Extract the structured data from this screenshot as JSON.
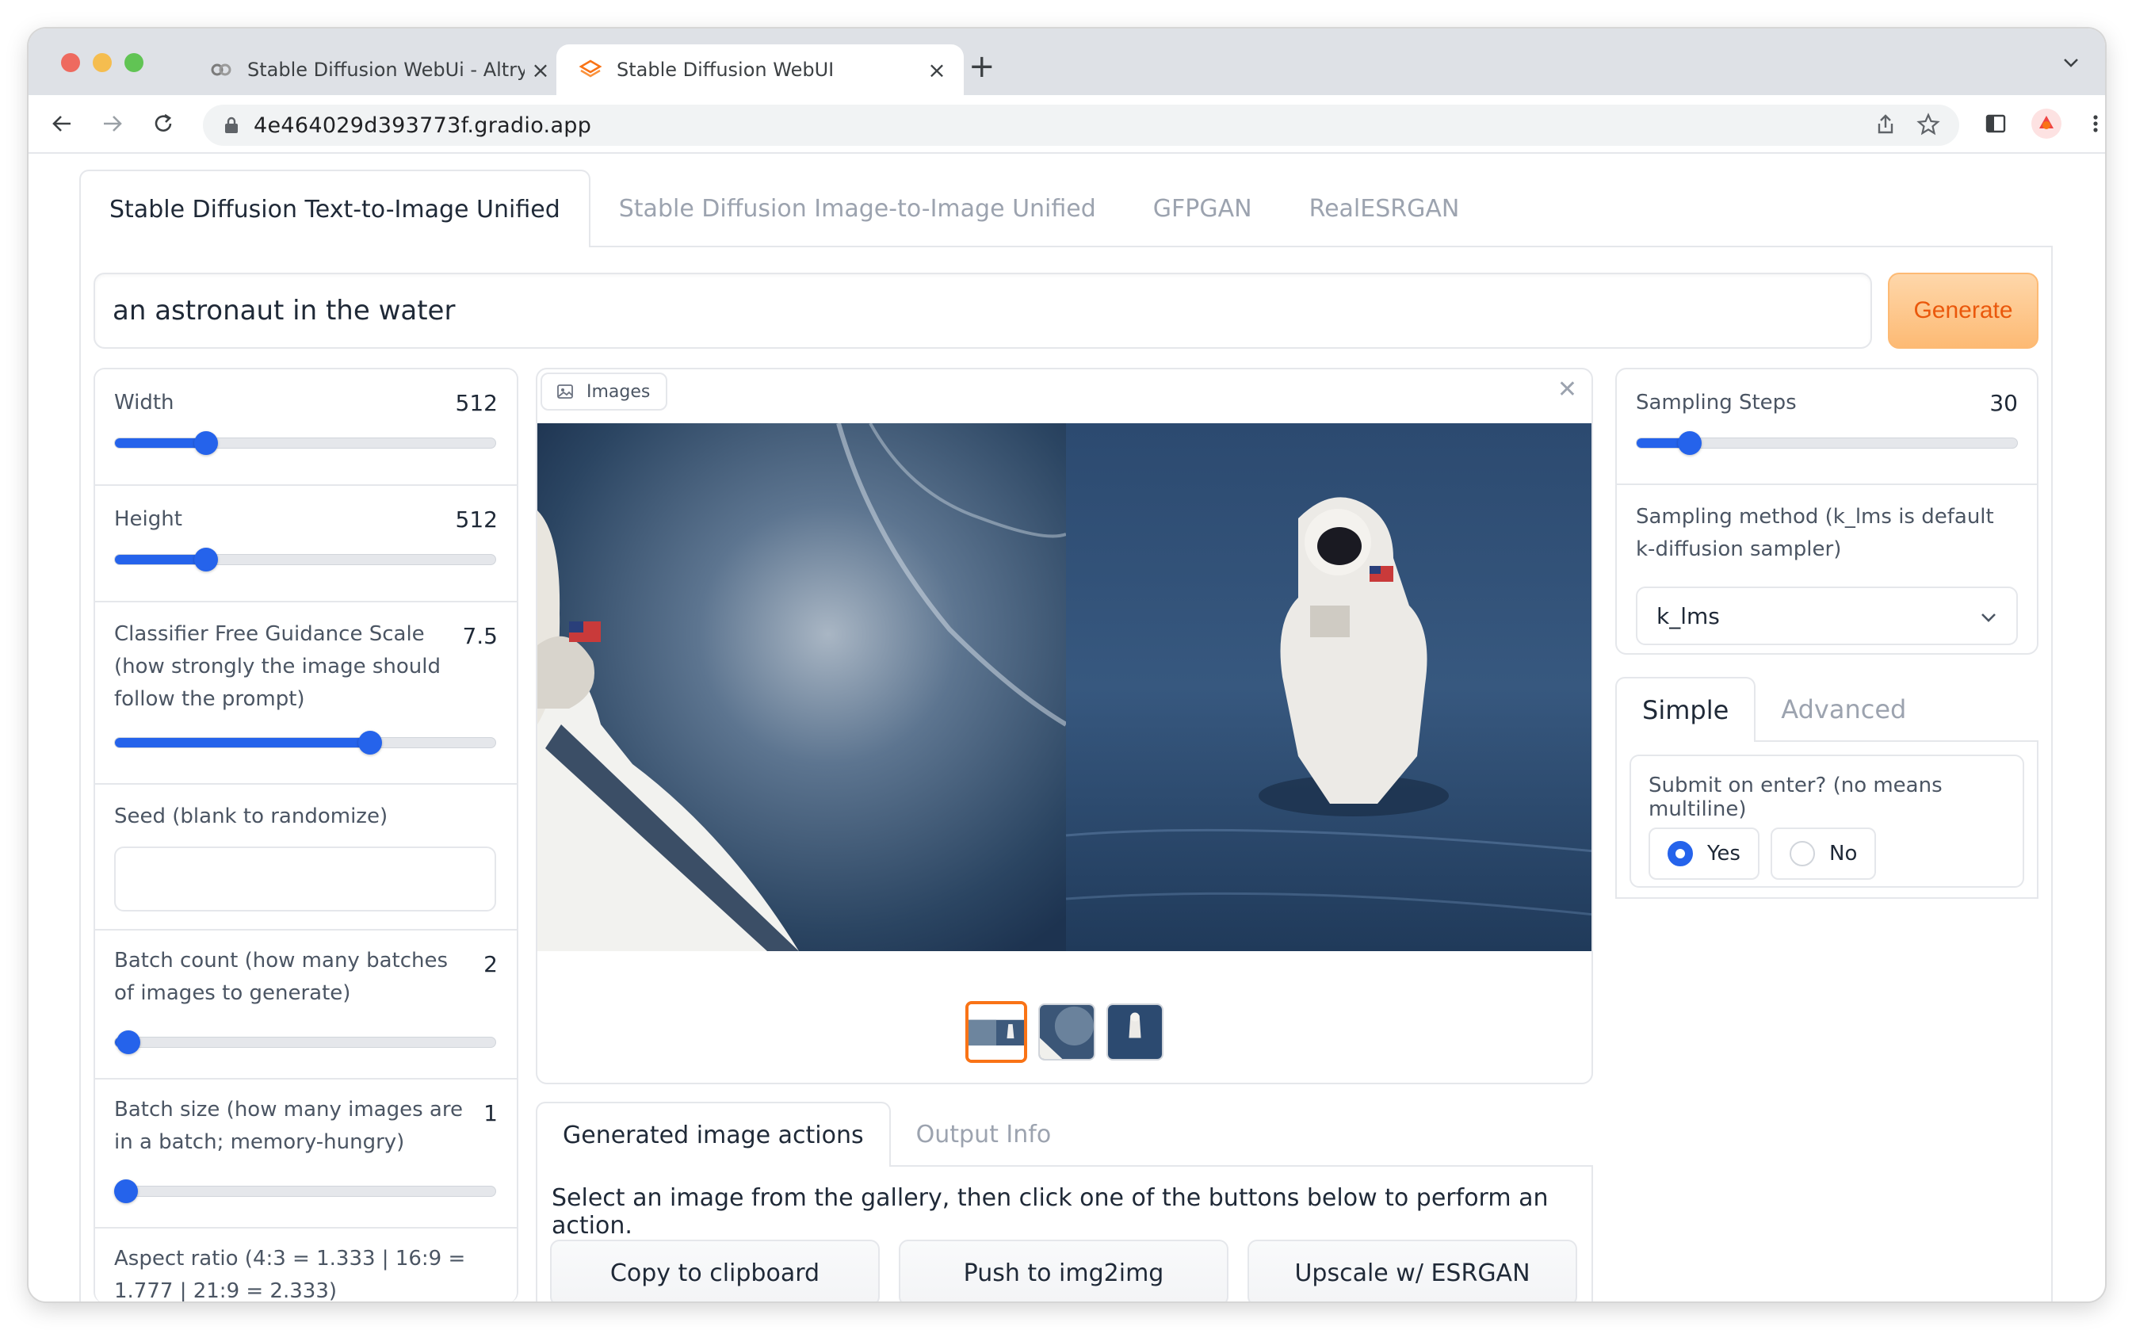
{
  "browser": {
    "tabs": [
      {
        "title": "Stable Diffusion WebUi - Altryne",
        "active": false
      },
      {
        "title": "Stable Diffusion WebUI",
        "active": true
      }
    ],
    "url": "4e464029d393773f.gradio.app"
  },
  "app": {
    "main_tabs": [
      {
        "label": "Stable Diffusion Text-to-Image Unified",
        "active": true
      },
      {
        "label": "Stable Diffusion Image-to-Image Unified",
        "active": false
      },
      {
        "label": "GFPGAN",
        "active": false
      },
      {
        "label": "RealESRGAN",
        "active": false
      }
    ],
    "prompt": "an astronaut in the water",
    "generate_label": "Generate",
    "left": {
      "width": {
        "label": "Width",
        "value": "512",
        "fraction": 0.24
      },
      "height": {
        "label": "Height",
        "value": "512",
        "fraction": 0.24
      },
      "cfg": {
        "label": "Classifier Free Guidance Scale (how strongly the image should follow the prompt)",
        "value": "7.5",
        "fraction": 0.67
      },
      "seed": {
        "label": "Seed (blank to randomize)",
        "value": ""
      },
      "batch_count": {
        "label": "Batch count (how many batches of images to generate)",
        "value": "2",
        "fraction": 0.035
      },
      "batch_size": {
        "label": "Batch size (how many images are in a batch; memory-hungry)",
        "value": "1",
        "fraction": 0.03
      },
      "aspect": {
        "label": "Aspect ratio (4:3 = 1.333 | 16:9 = 1.777 | 21:9 = 2.333)"
      }
    },
    "gallery": {
      "label": "Images",
      "thumbnail_count": 3,
      "selected_index": 0
    },
    "actions": {
      "tabs": [
        {
          "label": "Generated image actions",
          "active": true
        },
        {
          "label": "Output Info",
          "active": false
        }
      ],
      "instruction": "Select an image from the gallery, then click one of the buttons below to perform an action.",
      "buttons": [
        "Copy to clipboard",
        "Push to img2img",
        "Upscale w/ ESRGAN"
      ]
    },
    "right": {
      "steps": {
        "label": "Sampling Steps",
        "value": "30",
        "fraction": 0.14
      },
      "sampler": {
        "label": "Sampling method (k_lms is default k-diffusion sampler)",
        "value": "k_lms"
      },
      "mode_tabs": [
        {
          "label": "Simple",
          "active": true
        },
        {
          "label": "Advanced",
          "active": false
        }
      ],
      "submit": {
        "label": "Submit on enter? (no means multiline)",
        "options": [
          "Yes",
          "No"
        ],
        "selected": "Yes"
      }
    }
  },
  "colors": {
    "accent": "#2563eb",
    "generate": "#ea580c",
    "selected_thumb": "#f97316"
  }
}
